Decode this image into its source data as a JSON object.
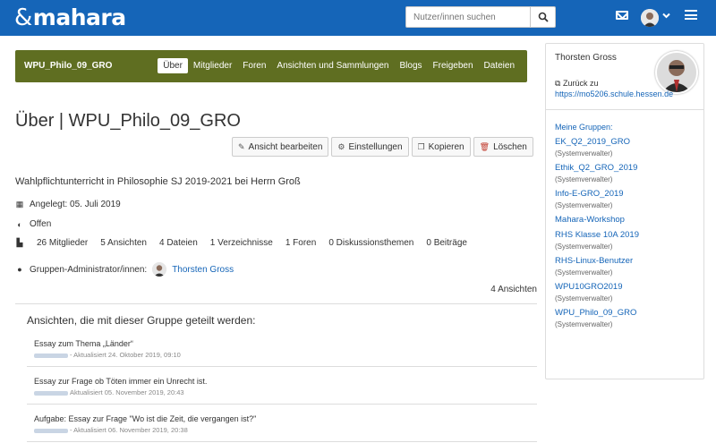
{
  "header": {
    "logo": "mahara",
    "search_placeholder": "Nutzer/innen suchen",
    "icons": [
      "mail-icon",
      "avatar",
      "chevron-down-icon",
      "menu-icon"
    ]
  },
  "group": {
    "name": "WPU_Philo_09_GRO",
    "tabs": [
      "Über",
      "Mitglieder",
      "Foren",
      "Ansichten und Sammlungen",
      "Blogs",
      "Freigeben",
      "Dateien"
    ],
    "active_tab": "Über"
  },
  "page": {
    "title": "Über | WPU_Philo_09_GRO",
    "actions": {
      "edit": "Ansicht bearbeiten",
      "settings": "Einstellungen",
      "copy": "Kopieren",
      "delete": "Löschen"
    },
    "description": "Wahlpflichtunterricht in Philosophie SJ 2019-2021 bei Herrn Groß",
    "created": "Angelegt: 05. Juli 2019",
    "visibility": "Offen",
    "stats": [
      "26 Mitglieder",
      "5 Ansichten",
      "4 Dateien",
      "1 Verzeichnisse",
      "1 Foren",
      "0 Diskussionsthemen",
      "0 Beiträge"
    ],
    "admins_label": "Gruppen-Administrator/innen:",
    "admin_name": "Thorsten Gross",
    "views_count": "4 Ansichten",
    "shared_title": "Ansichten, die mit dieser Gruppe geteilt werden:",
    "shared_views": [
      {
        "title": "Essay zum Thema „Länder“",
        "updated": "- Aktualisiert 24. Oktober 2019, 09:10"
      },
      {
        "title": "Essay zur Frage ob Töten immer ein Unrecht ist.",
        "updated": "Aktualisiert 05. November 2019, 20:43"
      },
      {
        "title": "Aufgabe: Essay zur Frage \"Wo ist die Zeit, die vergangen ist?\"",
        "updated": "- Aktualisiert 06. November 2019, 20:38"
      }
    ]
  },
  "sidebar": {
    "user_name": "Thorsten Gross",
    "back_prefix": "Zurück zu",
    "back_link": "https://mo5206.schule.hessen.de",
    "my_groups_label": "Meine Gruppen:",
    "groups": [
      {
        "name": "EK_Q2_2019_GRO",
        "role": "(Systemverwalter)"
      },
      {
        "name": "Ethik_Q2_GRO_2019",
        "role": "(Systemverwalter)"
      },
      {
        "name": "Info-E-GRO_2019",
        "role": "(Systemverwalter)"
      },
      {
        "name": "Mahara-Workshop",
        "role": ""
      },
      {
        "name": "RHS Klasse 10A 2019",
        "role": "(Systemverwalter)"
      },
      {
        "name": "RHS-Linux-Benutzer",
        "role": "(Systemverwalter)"
      },
      {
        "name": "WPU10GRO2019",
        "role": "(Systemverwalter)"
      },
      {
        "name": "WPU_Philo_09_GRO",
        "role": "(Systemverwalter)"
      }
    ]
  }
}
